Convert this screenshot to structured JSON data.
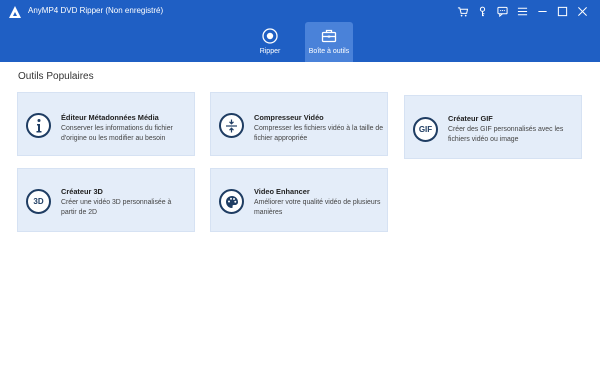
{
  "app": {
    "title": "AnyMP4 DVD Ripper (Non enregistré)"
  },
  "icons": {
    "logo": "anymp4-logo",
    "cart": "cart-icon",
    "key": "key-icon",
    "chat": "chat-icon",
    "menu": "menu-icon",
    "minimize": "minimize-icon",
    "maximize": "maximize-icon",
    "close": "close-icon"
  },
  "tabs": [
    {
      "label": "Ripper",
      "icon": "disc-icon",
      "active": false
    },
    {
      "label": "Boîte à outils",
      "icon": "toolbox-icon",
      "active": true
    }
  ],
  "section": {
    "title": "Outils Populaires"
  },
  "tools": [
    {
      "title": "Éditeur Métadonnées Média",
      "desc": "Conserver les informations du fichier d'origine ou les modifier au besoin",
      "icon": "info-icon"
    },
    {
      "title": "Compresseur Vidéo",
      "desc": "Compresser les fichiers vidéo à la taille de fichier appropriée",
      "icon": "compress-icon"
    },
    {
      "title": "Créateur GIF",
      "desc": "Créer des GIF personnalisés avec les fichiers vidéo ou image",
      "icon": "gif-icon",
      "icon_text": "GIF"
    },
    {
      "title": "Créateur 3D",
      "desc": "Créer une vidéo 3D personnalisée à partir de 2D",
      "icon": "3d-icon",
      "icon_text": "3D"
    },
    {
      "title": "Video Enhancer",
      "desc": "Améliorer votre qualité vidéo de plusieurs manières",
      "icon": "palette-icon"
    }
  ],
  "colors": {
    "header": "#1f5fc4",
    "active_tab": "#4a82d9",
    "card_bg": "#e4edf9",
    "icon_dark": "#1f3d63"
  }
}
